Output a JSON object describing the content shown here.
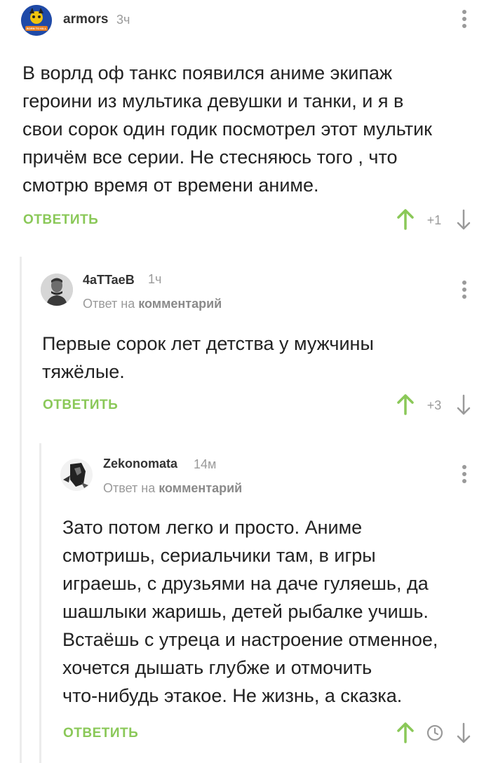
{
  "comments": [
    {
      "author": "armors",
      "time": "3ч",
      "reply_prefix": "",
      "reply_target": "",
      "text_lines": [
        "В ворлд оф танкс появился аниме экипаж",
        "героини из мультика девушки и танки, и я в",
        "свои сорок один годик посмотрел этот мультик",
        "причём все серии. Не стесняюсь того , что",
        "смотрю время от времени аниме."
      ],
      "reply_label": "ОТВЕТИТЬ",
      "rating": "+1",
      "avatar_text": "BORN TO KILL"
    },
    {
      "author": "4aTTaeB",
      "time": "1ч",
      "reply_prefix": "Ответ на ",
      "reply_target": "комментарий",
      "text_lines": [
        "Первые сорок лет детства у мужчины",
        "тяжёлые."
      ],
      "reply_label": "ОТВЕТИТЬ",
      "rating": "+3"
    },
    {
      "author": "Zekonomata",
      "time": "14м",
      "reply_prefix": "Ответ на ",
      "reply_target": "комментарий",
      "text_lines": [
        "Зато потом легко и просто. Аниме",
        "смотришь, сериальчики там, в игры",
        "играешь, с друзьями на даче гуляешь, да",
        "шашлыки жаришь, детей рыбалке учишь.",
        "Встаёшь с утреца и настроение отменное,",
        "хочется дышать глубже и отмочить",
        "что-нибудь этакое. Не жизнь, а сказка."
      ],
      "reply_label": "ОТВЕТИТЬ",
      "rating_icon": "clock-icon"
    }
  ],
  "colors": {
    "accent_green": "#8ac858",
    "muted_gray": "#9a9a9a",
    "thread_line": "#ececec"
  }
}
